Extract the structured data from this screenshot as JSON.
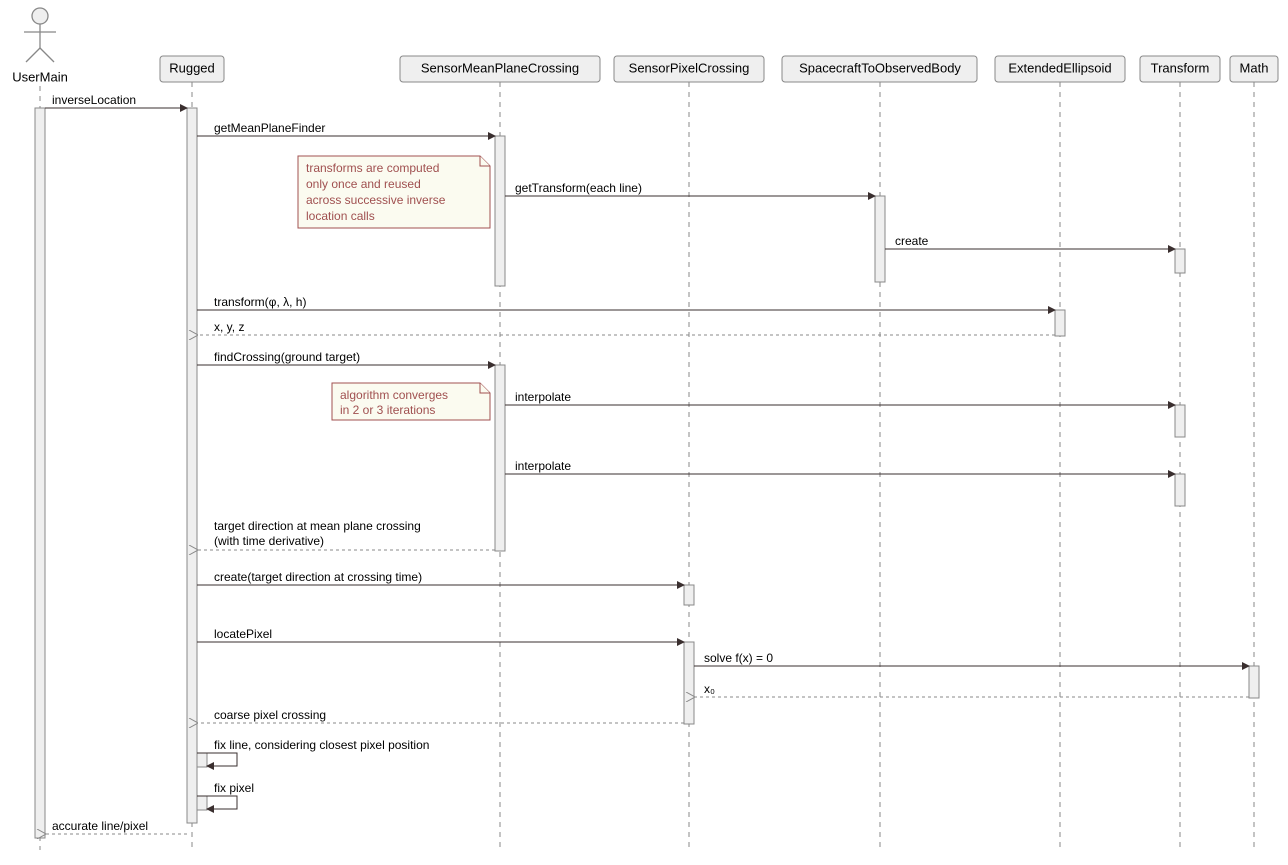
{
  "participants": {
    "actor": "UserMain",
    "p1": "Rugged",
    "p2": "SensorMeanPlaneCrossing",
    "p3": "SensorPixelCrossing",
    "p4": "SpacecraftToObservedBody",
    "p5": "ExtendedEllipsoid",
    "p6": "Transform",
    "p7": "Math"
  },
  "messages": {
    "m1": "inverseLocation",
    "m2": "getMeanPlaneFinder",
    "m3": "getTransform(each line)",
    "m4": "create",
    "m5": "transform(φ, λ, h)",
    "m6": "x, y, z",
    "m7": "findCrossing(ground target)",
    "m8": "interpolate",
    "m9": "interpolate",
    "m10": "target direction at mean plane crossing\n(with time derivative)",
    "m11": "create(target direction at crossing time)",
    "m12": "locatePixel",
    "m13": "solve f(x) = 0",
    "m14": "x₀",
    "m15": "coarse pixel crossing",
    "m16": "fix line, considering closest pixel position",
    "m17": "fix pixel",
    "m18": "accurate line/pixel"
  },
  "notes": {
    "n1": "transforms are computed\nonly once and reused\nacross successive inverse\nlocation calls",
    "n2": "algorithm converges\nin 2 or 3 iterations"
  }
}
